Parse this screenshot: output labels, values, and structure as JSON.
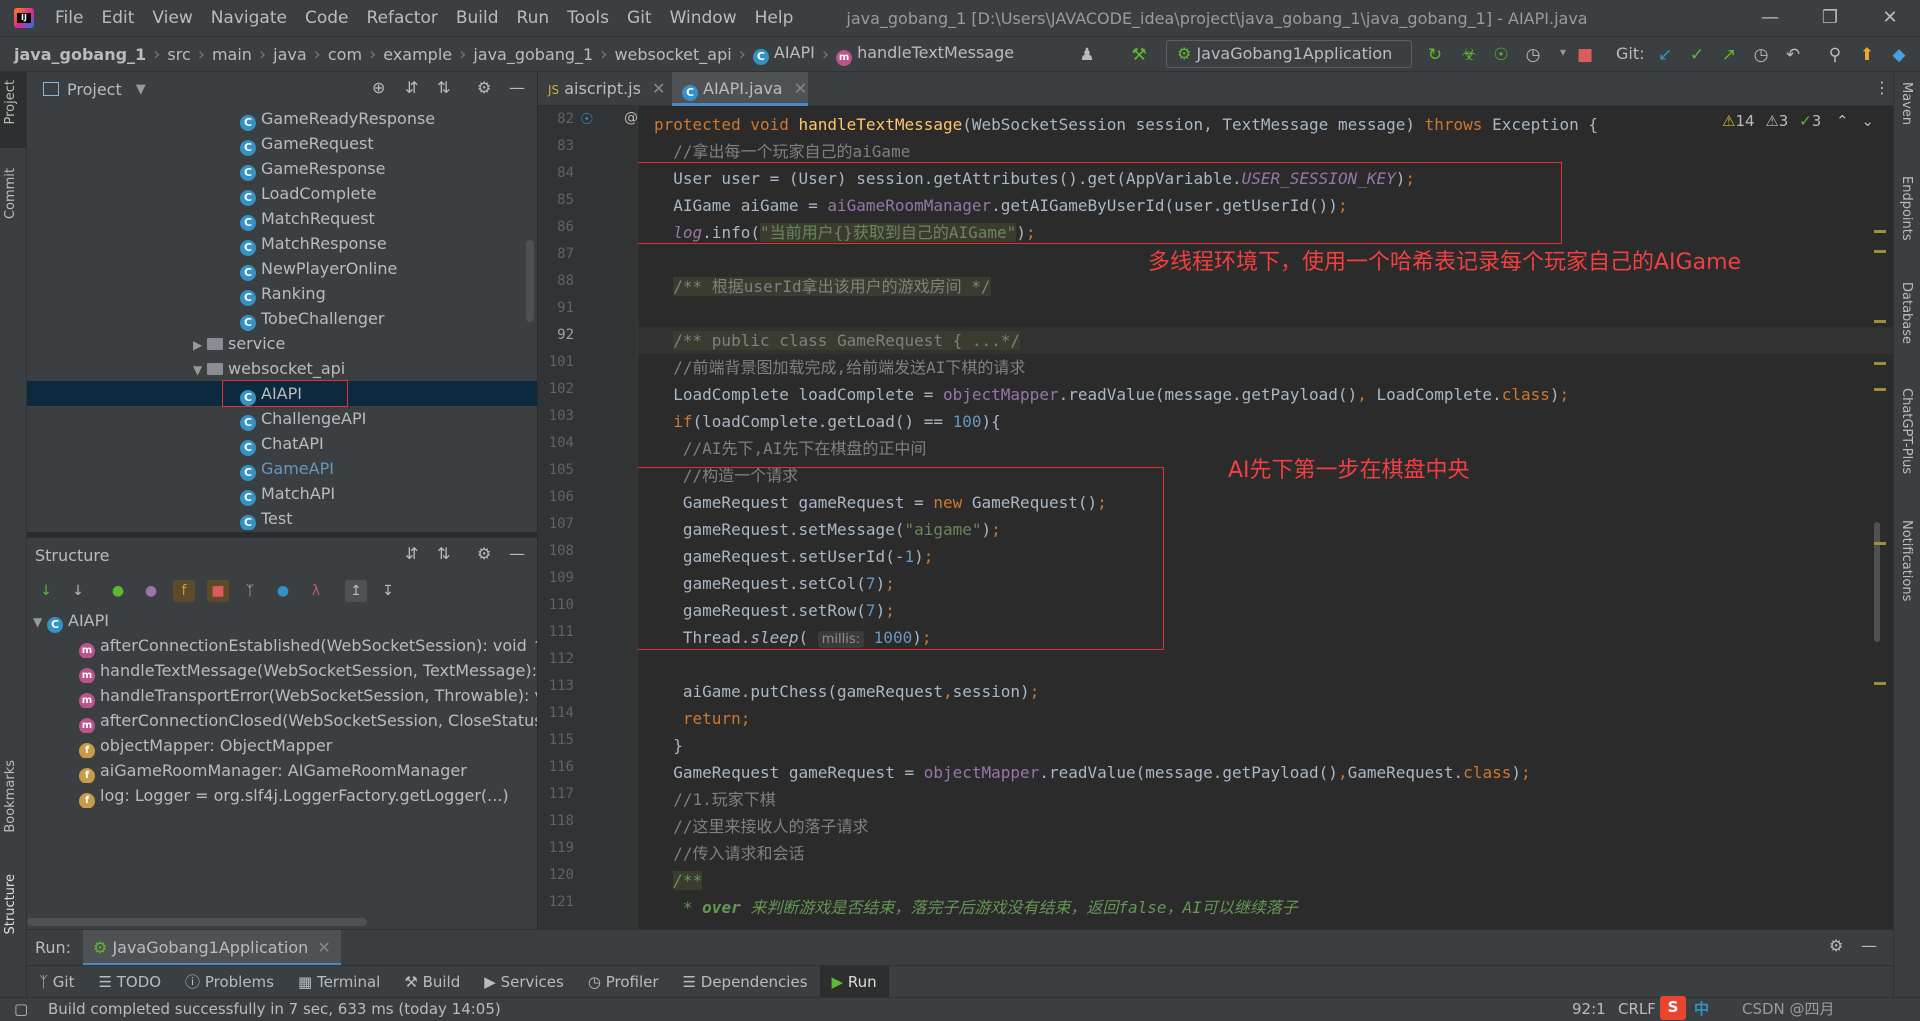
{
  "menubar": {
    "items": [
      "File",
      "Edit",
      "View",
      "Navigate",
      "Code",
      "Refactor",
      "Build",
      "Run",
      "Tools",
      "Git",
      "Window",
      "Help"
    ],
    "window_title": "java_gobang_1 [D:\\Users\\JAVACODE_idea\\project\\java_gobang_1\\java_gobang_1] - AIAPI.java"
  },
  "breadcrumb": [
    "java_gobang_1",
    "src",
    "main",
    "java",
    "com",
    "example",
    "java_gobang_1",
    "websocket_api",
    "AIAPI",
    "handleTextMessage"
  ],
  "toolbar": {
    "run_config": "JavaGobang1Application",
    "git_label": "Git:"
  },
  "project_panel": {
    "title": "Project",
    "items": [
      {
        "label": "GameReadyResponse",
        "type": "class"
      },
      {
        "label": "GameRequest",
        "type": "class"
      },
      {
        "label": "GameResponse",
        "type": "class"
      },
      {
        "label": "LoadComplete",
        "type": "class"
      },
      {
        "label": "MatchRequest",
        "type": "class"
      },
      {
        "label": "MatchResponse",
        "type": "class"
      },
      {
        "label": "NewPlayerOnline",
        "type": "class"
      },
      {
        "label": "Ranking",
        "type": "class"
      },
      {
        "label": "TobeChallenger",
        "type": "class"
      },
      {
        "label": "service",
        "type": "folder"
      },
      {
        "label": "websocket_api",
        "type": "folder"
      },
      {
        "label": "AIAPI",
        "type": "class"
      },
      {
        "label": "ChallengeAPI",
        "type": "class"
      },
      {
        "label": "ChatAPI",
        "type": "class"
      },
      {
        "label": "GameAPI",
        "type": "class"
      },
      {
        "label": "MatchAPI",
        "type": "class"
      },
      {
        "label": "Test",
        "type": "class"
      }
    ]
  },
  "structure_panel": {
    "title": "Structure",
    "root": "AIAPI",
    "members": [
      "afterConnectionEstablished(WebSocketSession): void ↑A",
      "handleTextMessage(WebSocketSession, TextMessage): v",
      "handleTransportError(WebSocketSession, Throwable): vc",
      "afterConnectionClosed(WebSocketSession, CloseStatus):",
      "objectMapper: ObjectMapper",
      "aiGameRoomManager: AIGameRoomManager",
      "log: Logger = org.slf4j.LoggerFactory.getLogger(...)"
    ]
  },
  "editor": {
    "tabs": [
      "aiscript.js",
      "AIAPI.java"
    ],
    "inspections": {
      "warnings": "14",
      "weak": "3",
      "ok": "3"
    },
    "line_numbers": [
      "82",
      "83",
      "84",
      "85",
      "86",
      "87",
      "88",
      "91",
      "92",
      "101",
      "102",
      "103",
      "104",
      "105",
      "106",
      "107",
      "108",
      "109",
      "110",
      "111",
      "112",
      "113",
      "114",
      "115",
      "116",
      "117",
      "118",
      "119",
      "120",
      "121"
    ],
    "annotation_1": "多线程环境下，使用一个哈希表记录每个玩家自己的AIGame",
    "annotation_2": "AI先下第一步在棋盘中央",
    "param_hint": "millis:"
  },
  "left_strip": {
    "project": "Project",
    "commit": "Commit",
    "bookmarks": "Bookmarks",
    "structure": "Structure"
  },
  "right_strip": {
    "maven": "Maven",
    "endpoints": "Endpoints",
    "database": "Database",
    "chatgpt": "ChatGPT-Plus",
    "notifications": "Notifications"
  },
  "run_bar": {
    "label": "Run:",
    "config": "JavaGobang1Application"
  },
  "bottom_tools": [
    "Git",
    "TODO",
    "Problems",
    "Terminal",
    "Build",
    "Services",
    "Profiler",
    "Dependencies",
    "Run"
  ],
  "status": {
    "message": "Build completed successfully in 7 sec, 633 ms (today 14:05)",
    "position": "92:1",
    "line_sep": "CRLF",
    "tray": "中",
    "watermark": "CSDN @四月"
  }
}
